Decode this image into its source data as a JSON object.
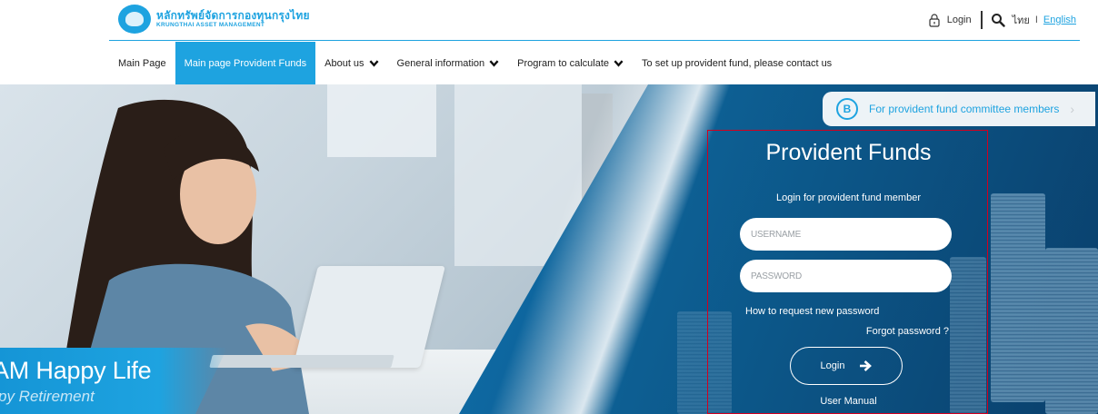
{
  "brand": {
    "name_th": "หลักทรัพย์จัดการกองทุนกรุงไทย",
    "name_en": "KRUNGTHAI ASSET MANAGEMENT",
    "primary_color": "#1ea3e0"
  },
  "utility": {
    "login_label": "Login",
    "lang_th": "ไทย",
    "lang_sep": "I",
    "lang_en": "English"
  },
  "nav": {
    "items": [
      {
        "label": "Main Page",
        "active": false,
        "has_dropdown": false
      },
      {
        "label": "Main page Provident Funds",
        "active": true,
        "has_dropdown": false
      },
      {
        "label": "About us",
        "active": false,
        "has_dropdown": true
      },
      {
        "label": "General information",
        "active": false,
        "has_dropdown": true
      },
      {
        "label": "Program to calculate",
        "active": false,
        "has_dropdown": true
      },
      {
        "label": "To set up provident fund, please contact us",
        "active": false,
        "has_dropdown": false
      }
    ]
  },
  "committee": {
    "badge": "B",
    "label": "For provident fund committee members",
    "arrow": "›"
  },
  "hero": {
    "title": "AM Happy Life",
    "subtitle": "py Retirement"
  },
  "login": {
    "title": "Provident Funds",
    "subtitle": "Login for provident fund member",
    "username_placeholder": "USERNAME",
    "password_placeholder": "PASSWORD",
    "howto_label": "How to request new password",
    "forgot_label": "Forgot password ?",
    "button_label": "Login",
    "manual_label": "User Manual"
  }
}
